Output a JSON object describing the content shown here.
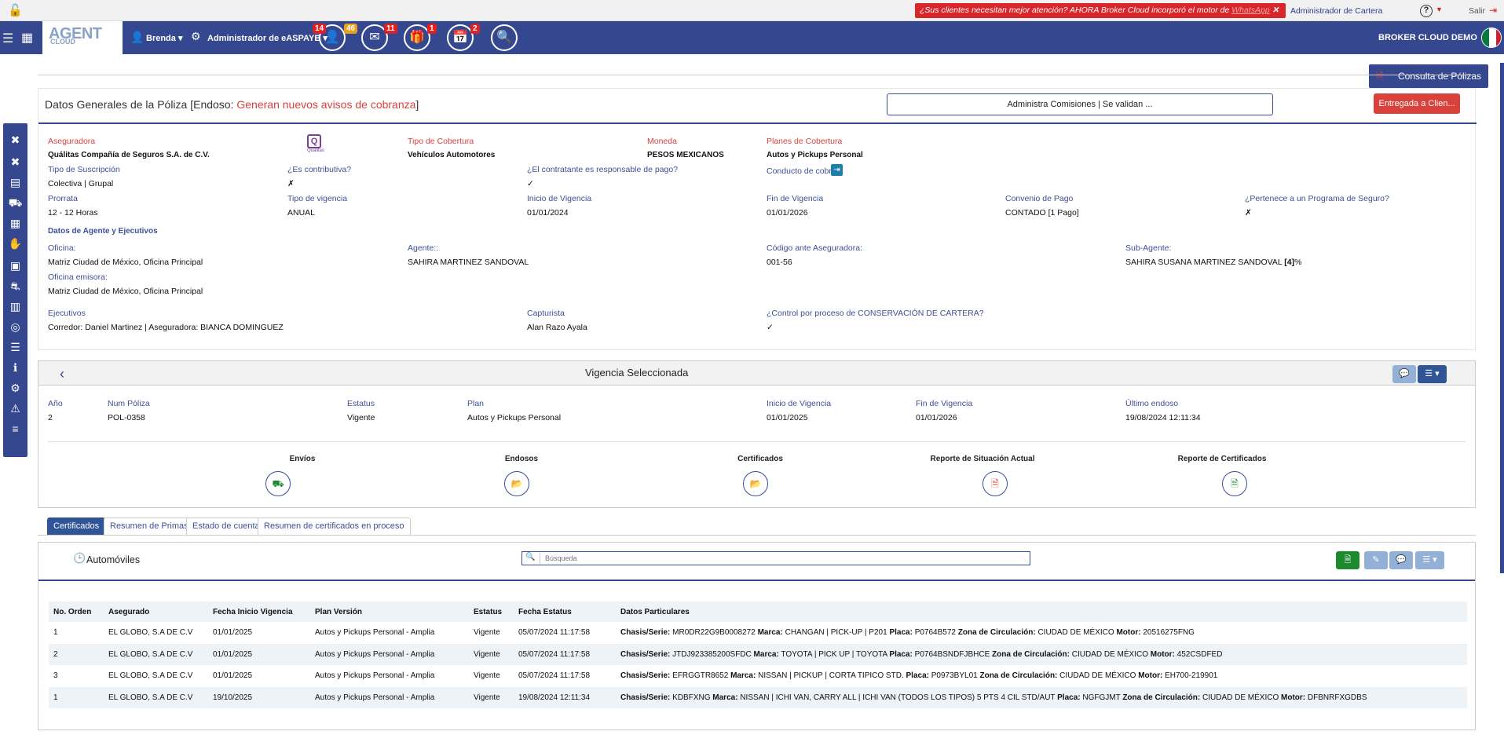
{
  "top": {
    "promo_text": "¿Sus clientes necesitan mejor atención? AHORA Broker Cloud incorporó el motor de",
    "promo_link": "WhatsApp",
    "admin_cartera": "Administrador de Cartera",
    "help": "?",
    "salir": "Salir"
  },
  "nav": {
    "logo_main": "AGENT",
    "logo_sub": "CLOUD",
    "user": "Brenda",
    "role": "Administrador de eASPAYB",
    "badges": [
      "14",
      "46",
      "11",
      "1",
      "2"
    ],
    "brand": "BROKER CLOUD DEMO"
  },
  "consulta": "Consulta de Pólizas",
  "general": {
    "title_prefix": "Datos Generales de la Póliza [Endoso:",
    "title_highlight": "Generan nuevos avisos de cobranza",
    "title_suffix": "]",
    "comisiones_btn": "Administra Comisiones | Se validan ...",
    "entregada_btn": "Entregada a Clien...",
    "aseguradora_lbl": "Aseguradora",
    "aseguradora_val": "Quálitas Compañía de Seguros S.A. de C.V.",
    "logo_text": "Qualitas",
    "tipo_cob_lbl": "Tipo de Cobertura",
    "tipo_cob_val": "Vehículos Automotores",
    "moneda_lbl": "Moneda",
    "moneda_val": "PESOS MEXICANOS",
    "planes_lbl": "Planes de Cobertura",
    "planes_val": "Autos y Pickups Personal",
    "tipo_susc_lbl": "Tipo de Suscripción",
    "tipo_susc_val": "Colectiva | Grupal",
    "contrib_lbl": "¿Es contributiva?",
    "contrib_val": "✗",
    "resp_pago_lbl": "¿El contratante es responsable de pago?",
    "resp_pago_val": "✓",
    "conducto_lbl": "Conducto de cobro",
    "prorrata_lbl": "Prorrata",
    "prorrata_val": "12 - 12 Horas",
    "tipo_vig_lbl": "Tipo de vigencia",
    "tipo_vig_val": "ANUAL",
    "inicio_lbl": "Inicio de Vigencia",
    "inicio_val": "01/01/2024",
    "fin_lbl": "Fin de Vigencia",
    "fin_val": "01/01/2026",
    "convenio_lbl": "Convenio de Pago",
    "convenio_val": "CONTADO [1 Pago]",
    "programa_lbl": "¿Pertenece a un Programa de Seguro?",
    "programa_val": "✗",
    "agentes_hdr": "Datos de Agente y Ejecutivos",
    "oficina_lbl": "Oficina:",
    "oficina_val": "Matriz Ciudad de México, Oficina Principal",
    "agente_lbl": "Agente::",
    "agente_val": "SAHIRA MARTINEZ SANDOVAL",
    "codigo_lbl": "Código ante Aseguradora:",
    "codigo_val": "001-56",
    "subagente_lbl": "Sub-Agente:",
    "subagente_val": "SAHIRA SUSANA MARTINEZ SANDOVAL",
    "subagente_pct": "[4]",
    "subagente_pct_sfx": "%",
    "emisora_lbl": "Oficina emisora:",
    "emisora_val": "Matriz Ciudad de México, Oficina Principal",
    "ejecutivos_lbl": "Ejecutivos",
    "ejecutivos_val": "Corredor: Daniel Martinez | Aseguradora: BIANCA DOMINGUEZ",
    "capturista_lbl": "Capturista",
    "capturista_val": "Alan Razo Ayala",
    "control_lbl": "¿Control por proceso de CONSERVACIÓN DE CARTERA?",
    "control_val": "✓"
  },
  "vigencia": {
    "title": "Vigencia Seleccionada",
    "anio_lbl": "Año",
    "anio_val": "2",
    "num_lbl": "Num Póliza",
    "num_val": "POL-0358",
    "estatus_lbl": "Estatus",
    "estatus_val": "Vigente",
    "plan_lbl": "Plan",
    "plan_val": "Autos y Pickups Personal",
    "inicio_lbl": "Inicio de Vigencia",
    "inicio_val": "01/01/2025",
    "fin_lbl": "Fin de Vigencia",
    "fin_val": "01/01/2026",
    "endoso_lbl": "Último endoso",
    "endoso_val": "19/08/2024 12:11:34",
    "actions": [
      "Envíos",
      "Endosos",
      "Certificados",
      "Reporte de Situación Actual",
      "Reporte de Certificados"
    ]
  },
  "tabs": [
    "Certificados",
    "Resumen de Primas",
    "Estado de cuenta",
    "Resumen de certificados en proceso"
  ],
  "cert": {
    "title": "Automóviles",
    "search_placeholder": "Búsqueda",
    "columns": [
      "No. Orden",
      "Asegurado",
      "Fecha Inicio Vigencia",
      "Plan Versión",
      "Estatus",
      "Fecha Estatus",
      "Datos Particulares"
    ],
    "rows": [
      {
        "orden": "1",
        "asegurado": "EL GLOBO, S.A DE C.V",
        "fecha": "01/01/2025",
        "plan": "Autos y Pickups Personal - Amplia",
        "estatus": "Vigente",
        "festatus": "05/07/2024 11:17:58",
        "chasis": "MR0DR22G9B0008272",
        "marca": "CHANGAN | PICK-UP | P201",
        "placa": "P0764B572",
        "zona": "CIUDAD DE MÉXICO",
        "motor": "20516275FNG"
      },
      {
        "orden": "2",
        "asegurado": "EL GLOBO, S.A DE C.V",
        "fecha": "01/01/2025",
        "plan": "Autos y Pickups Personal - Amplia",
        "estatus": "Vigente",
        "festatus": "05/07/2024 11:17:58",
        "chasis": "JTDJ923385200SFDC",
        "marca": "TOYOTA | PICK UP | TOYOTA",
        "placa": "P0764BSNDFJBHCE",
        "zona": "CIUDAD DE MÉXICO",
        "motor": "452CSDFED"
      },
      {
        "orden": "3",
        "asegurado": "EL GLOBO, S.A DE C.V",
        "fecha": "01/01/2025",
        "plan": "Autos y Pickups Personal - Amplia",
        "estatus": "Vigente",
        "festatus": "05/07/2024 11:17:58",
        "chasis": "EFRGGTR8652",
        "marca": "NISSAN | PICKUP | CORTA TIPICO STD.",
        "placa": "P0973BYL01",
        "zona": "CIUDAD DE MÉXICO",
        "motor": "EH700-219901"
      },
      {
        "orden": "1",
        "asegurado": "EL GLOBO, S.A DE C.V",
        "fecha": "19/10/2025",
        "plan": "Autos y Pickups Personal - Amplia",
        "estatus": "Vigente",
        "festatus": "19/08/2024 12:11:34",
        "chasis": "KDBFXNG",
        "marca": "NISSAN | ICHI VAN, CARRY ALL | ICHI VAN (TODOS LOS TIPOS) 5 PTS 4 CIL STD/AUT",
        "placa": "NGFGJMT",
        "zona": "CIUDAD DE MÉXICO",
        "motor": "DFBNRFXGDBS"
      }
    ],
    "k_chasis": "Chasis/Serie:",
    "k_marca": "Marca:",
    "k_placa": "Placa:",
    "k_zona": "Zona de Circulación:",
    "k_motor": "Motor:"
  },
  "colors": {
    "nav": "#34478f",
    "accent_red": "#d9413b",
    "label_blue": "#3d4f99",
    "green": "#1d8a2e"
  }
}
